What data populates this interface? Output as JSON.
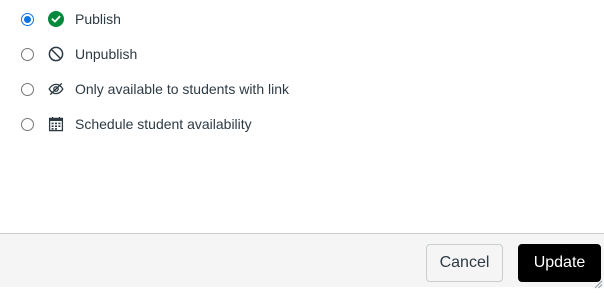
{
  "options": [
    {
      "label": "Publish",
      "icon": "published-check-icon",
      "selected": true
    },
    {
      "label": "Unpublish",
      "icon": "unpublished-icon",
      "selected": false
    },
    {
      "label": "Only available to students with link",
      "icon": "hidden-eye-icon",
      "selected": false
    },
    {
      "label": "Schedule student availability",
      "icon": "calendar-icon",
      "selected": false
    }
  ],
  "footer": {
    "cancel_label": "Cancel",
    "update_label": "Update"
  },
  "colors": {
    "radio_selected": "#0b74e5",
    "publish_green": "#03893d",
    "update_button_bg": "#000000",
    "text": "#2d3b45"
  }
}
